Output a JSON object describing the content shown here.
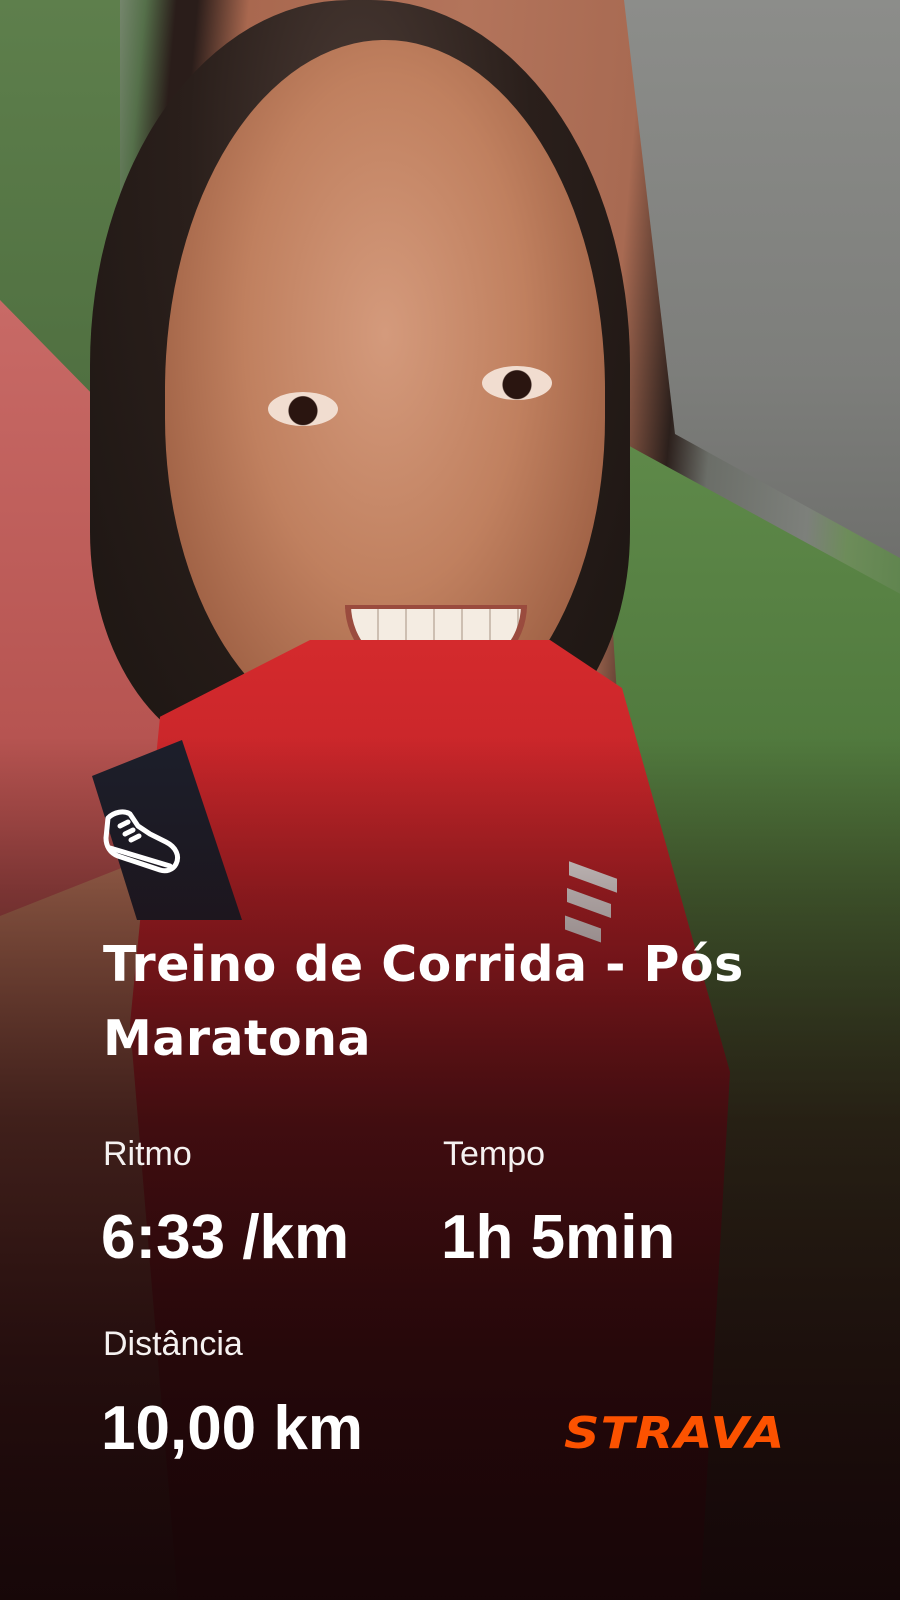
{
  "activity": {
    "icon": "running-shoe-icon",
    "title": "Treino de Corrida - Pós Maratona"
  },
  "stats": {
    "pace": {
      "label": "Ritmo",
      "value": "6:33 /km"
    },
    "time": {
      "label": "Tempo",
      "value": "1h 5min"
    },
    "distance": {
      "label": "Distância",
      "value": "10,00 km"
    }
  },
  "brand": {
    "name": "STRAVA",
    "color": "#fc5200"
  },
  "colors": {
    "text": "#ffffff",
    "shirt": "#d42a2d"
  }
}
